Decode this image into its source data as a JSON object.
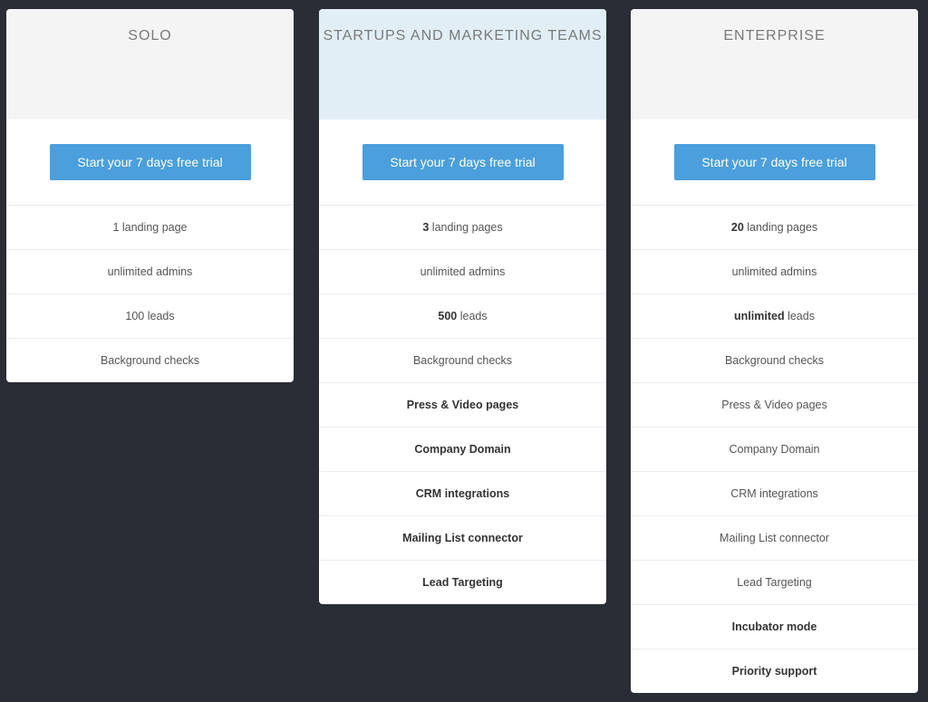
{
  "colors": {
    "background": "#2a2d35",
    "button": "#4a9fdc",
    "highlight_header": "#e1eef6",
    "header": "#f4f4f4"
  },
  "plans": [
    {
      "name": "SOLO",
      "cta_label": "Start your 7 days free trial",
      "features": [
        {
          "strong": "",
          "text": "1 landing page",
          "highlight": false
        },
        {
          "strong": "",
          "text": "unlimited admins",
          "highlight": false
        },
        {
          "strong": "",
          "text": "100 leads",
          "highlight": false
        },
        {
          "strong": "",
          "text": "Background checks",
          "highlight": false
        }
      ]
    },
    {
      "name": "STARTUPS AND MARKETING TEAMS",
      "cta_label": "Start your 7 days free trial",
      "features": [
        {
          "strong": "3",
          "text": " landing pages",
          "highlight": false
        },
        {
          "strong": "",
          "text": "unlimited admins",
          "highlight": false
        },
        {
          "strong": "500",
          "text": " leads",
          "highlight": false
        },
        {
          "strong": "",
          "text": "Background checks",
          "highlight": false
        },
        {
          "strong": "",
          "text": "Press & Video pages",
          "highlight": true
        },
        {
          "strong": "",
          "text": "Company Domain",
          "highlight": true
        },
        {
          "strong": "",
          "text": "CRM integrations",
          "highlight": true
        },
        {
          "strong": "",
          "text": "Mailing List connector",
          "highlight": true
        },
        {
          "strong": "",
          "text": "Lead Targeting",
          "highlight": true
        }
      ]
    },
    {
      "name": "ENTERPRISE",
      "cta_label": "Start your 7 days free trial",
      "features": [
        {
          "strong": "20",
          "text": " landing pages",
          "highlight": false
        },
        {
          "strong": "",
          "text": "unlimited admins",
          "highlight": false
        },
        {
          "strong": "unlimited",
          "text": " leads",
          "highlight": false
        },
        {
          "strong": "",
          "text": "Background checks",
          "highlight": false
        },
        {
          "strong": "",
          "text": "Press & Video pages",
          "highlight": false
        },
        {
          "strong": "",
          "text": "Company Domain",
          "highlight": false
        },
        {
          "strong": "",
          "text": "CRM integrations",
          "highlight": false
        },
        {
          "strong": "",
          "text": "Mailing List connector",
          "highlight": false
        },
        {
          "strong": "",
          "text": "Lead Targeting",
          "highlight": false
        },
        {
          "strong": "",
          "text": "Incubator mode",
          "highlight": true
        },
        {
          "strong": "",
          "text": "Priority support",
          "highlight": true
        }
      ]
    }
  ]
}
